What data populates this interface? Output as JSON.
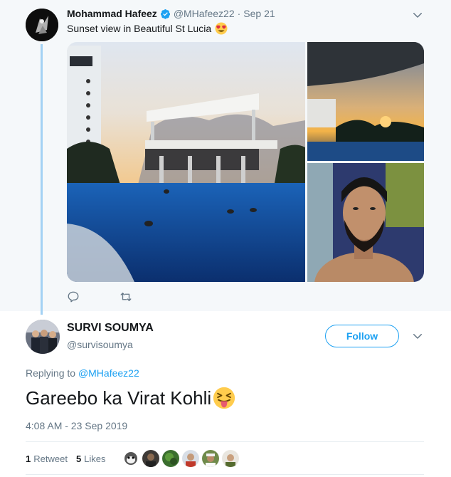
{
  "parent_tweet": {
    "author_name": "Mohammad Hafeez",
    "handle": "@MHafeez22",
    "separator": "·",
    "date": "Sep 21",
    "text": "Sunset view in Beautiful St Lucia",
    "emoji": "heart-eyes-emoji",
    "verified": true,
    "photos": [
      "resort-pool-sunset-photo",
      "infinity-pool-sunset-photo",
      "selfie-photo"
    ],
    "actions": [
      "reply-icon",
      "retweet-icon"
    ]
  },
  "reply_tweet": {
    "author_name": "SURVI SOUMYA",
    "handle": "@survisoumya",
    "follow_label": "Follow",
    "replying_prefix": "Replying to",
    "replying_to": "@MHafeez22",
    "text": "Gareebo ka Virat Kohli",
    "emoji": "squinting-tongue-emoji",
    "timestamp": "4:08 AM - 23 Sep 2019",
    "retweets_count": "1",
    "retweets_label": "Retweet",
    "likes_count": "5",
    "likes_label": "Likes",
    "likers": [
      "monkey-avatar",
      "dark-avatar",
      "green-avatar",
      "person-avatar",
      "cap-avatar",
      "smiling-avatar"
    ]
  },
  "colors": {
    "accent": "#1da1f2",
    "secondary_text": "#657786",
    "thread_line": "#a3d1f4",
    "parent_bg": "#f5f8fa"
  }
}
